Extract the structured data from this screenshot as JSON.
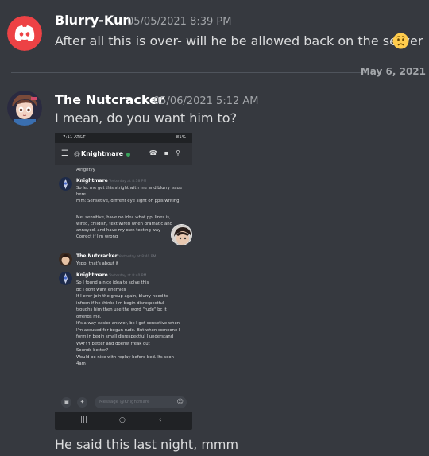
{
  "messages": [
    {
      "author": "Blurry-Kun",
      "timestamp": "05/05/2021 8:39 PM",
      "text": "After all this is over- will he be allowed back on the server",
      "emoji": "worried-face"
    },
    {
      "author": "The Nutcracker",
      "timestamp": "05/06/2021 5:12 AM",
      "text": "I mean, do you want him to?",
      "caption": "He said this last night, mmm"
    }
  ],
  "date_divider": "May 6, 2021",
  "colors": {
    "background": "#36393f",
    "discord_blurple": "#5865f2",
    "discord_red": "#ed4245",
    "online_green": "#3ba55d"
  },
  "screenshot": {
    "status_left": "7:11 AT&T",
    "status_right": "81%",
    "channel_name": "Knightmare",
    "messages": [
      {
        "lines": [
          "Alrightyy"
        ]
      },
      {
        "author": "Knightmare",
        "timestamp": "Yesterday at 8:38 PM",
        "lines": [
          "So let me get this stright with me and blurry issue",
          "here",
          "Him: Sensetive, diffrent eye sight on ppls writing",
          "",
          "Me: sensitive, have no idea what ppl lines is,",
          "wired, childish, text wired when dramatic and",
          "annoyed, and have my own texting way",
          "Correct if I'm wrong"
        ]
      },
      {
        "author": "The Nutcracker",
        "timestamp": "Yesterday at 8:40 PM",
        "lines": [
          "Yepp, that's about it"
        ]
      },
      {
        "author": "Knightmare",
        "timestamp": "Yesterday at 8:40 PM",
        "lines": [
          "So I found a nice idea to solve this",
          "Bc I dont want enemies",
          "If I ever join the group again, blurry need to",
          "infrom if he thinks I'm begin disrespectful",
          "troughs him then use the word \"rude\" bc it",
          "offends me.",
          "It's a way easier answer,  bc I get sensetive when",
          "I'm accused for begun rude. But when someone I",
          "form in begin small disrespectful I understand",
          "WAYYY better and doenst freak out",
          "Sounds better?",
          "Would be nice with replay before bed. Its soon",
          "4am"
        ]
      }
    ],
    "composer_placeholder": "Message @Knightmare"
  }
}
